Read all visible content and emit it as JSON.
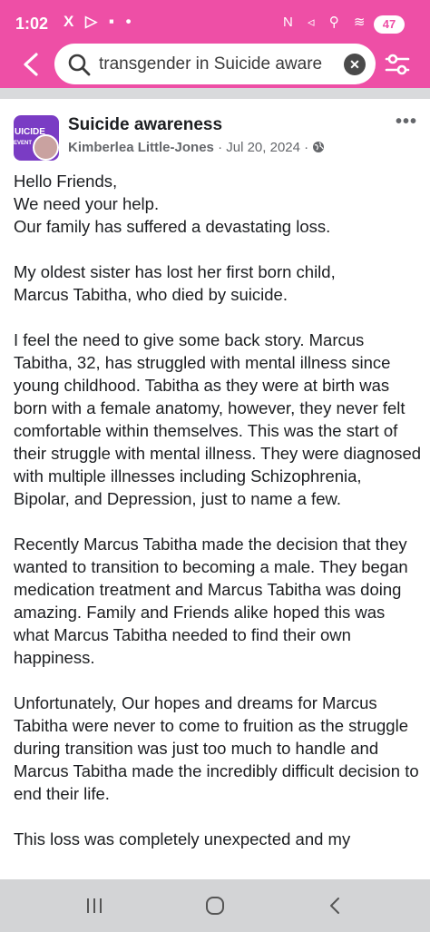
{
  "status_bar": {
    "time": "1:02",
    "left_icons": "X ▷ ▪ •",
    "right_icons": "N ◃ ⚲ ≋ ▮",
    "battery": "47"
  },
  "search": {
    "query": "transgender in Suicide aware"
  },
  "post": {
    "group_name": "Suicide awareness",
    "avatar_text_top": "UICIDE",
    "avatar_text_bottom": "EVENT",
    "author": "Kimberlea Little-Jones",
    "separator": "·",
    "date": "Jul 20, 2024",
    "paragraphs": [
      "Hello Friends,\nWe need your help.\nOur family has suffered a devastating loss.",
      "My oldest sister has lost her first born child,\nMarcus Tabitha, who died by suicide.",
      "I feel the need to give some back story. Marcus Tabitha, 32, has struggled with mental illness since young childhood. Tabitha as they were at birth was born with a female anatomy, however, they never felt comfortable within themselves. This was the start of their struggle with mental illness. They were diagnosed with multiple illnesses including Schizophrenia, Bipolar, and Depression, just to name a few.",
      "Recently Marcus Tabitha made the decision that they wanted to transition to becoming a male. They began medication treatment and Marcus Tabitha was doing amazing. Family and Friends alike hoped this was what Marcus Tabitha needed to find their own happiness.",
      "Unfortunately, Our hopes and dreams for Marcus Tabitha were never to come to fruition as the struggle during transition was just too much to handle and Marcus Tabitha made the incredibly difficult decision to end their life.",
      "This loss was completely unexpected and my"
    ]
  },
  "colors": {
    "brand_pink": "#ee4fa6",
    "text": "#1c1e21",
    "meta": "#65676b"
  },
  "icons": [
    "back-arrow-icon",
    "search-icon",
    "clear-icon",
    "filter-icon",
    "more-icon",
    "globe-icon",
    "recents-icon",
    "home-icon",
    "back-nav-icon"
  ]
}
